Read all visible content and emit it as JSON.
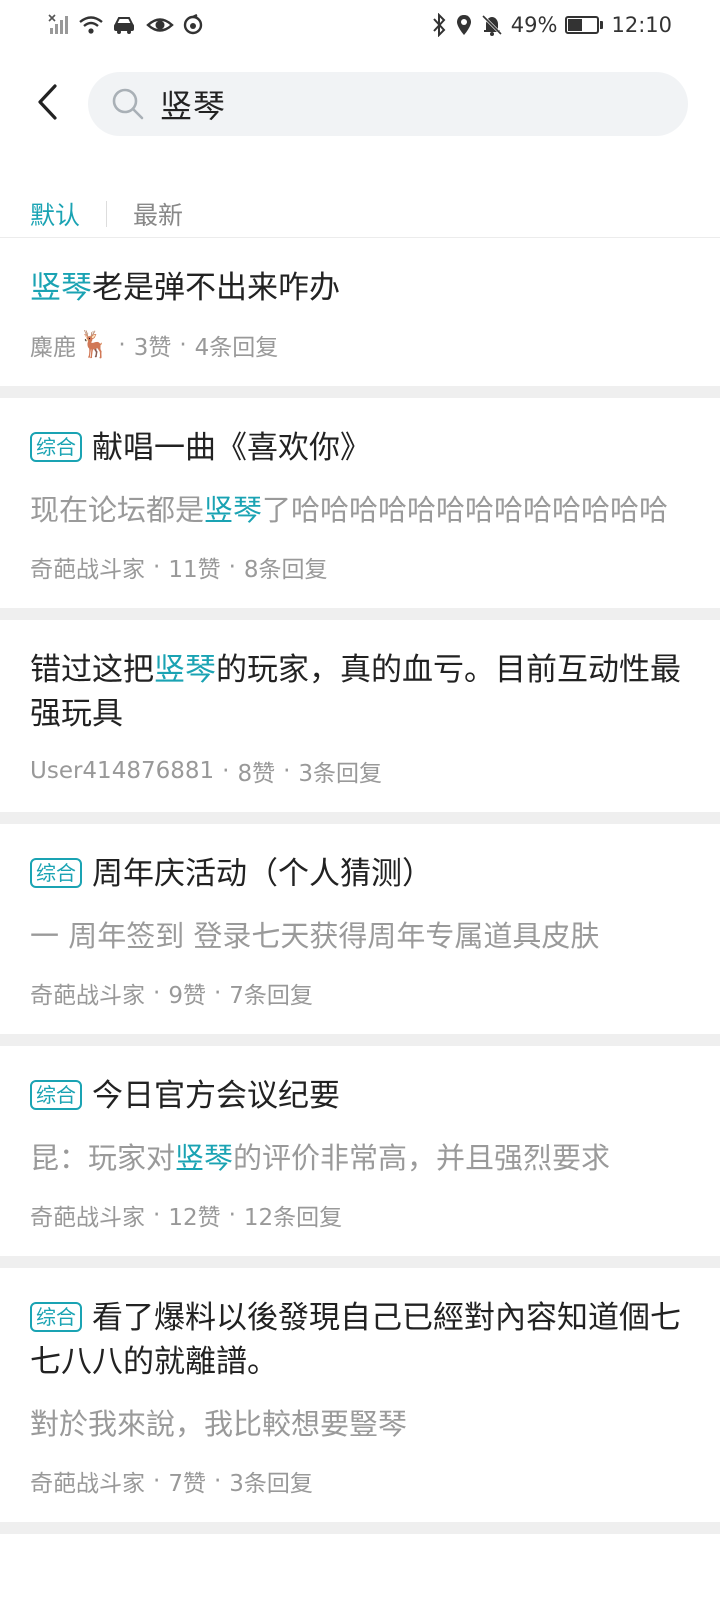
{
  "status_bar": {
    "battery_percent": "49%",
    "battery_level": 0.49,
    "time": "12:10"
  },
  "search": {
    "query": "竖琴"
  },
  "tabs": [
    {
      "label": "默认",
      "active": true
    },
    {
      "label": "最新",
      "active": false
    }
  ],
  "colors": {
    "accent": "#1aa3b3",
    "muted": "#999999"
  },
  "posts": [
    {
      "tag": "",
      "title_pre": "",
      "title_hl": "竖琴",
      "title_post": "老是弹不出来咋办",
      "excerpt_pre": "",
      "excerpt_hl": "",
      "excerpt_post": "",
      "author": "麋鹿",
      "author_emoji": "🦌",
      "likes": "3赞",
      "replies": "4条回复"
    },
    {
      "tag": "综合",
      "title_pre": "献唱一曲《喜欢你》",
      "title_hl": "",
      "title_post": "",
      "excerpt_pre": "现在论坛都是",
      "excerpt_hl": "竖琴",
      "excerpt_post": "了哈哈哈哈哈哈哈哈哈哈哈哈哈",
      "author": "奇葩战斗家",
      "author_emoji": "",
      "likes": "11赞",
      "replies": "8条回复"
    },
    {
      "tag": "",
      "title_pre": "错过这把",
      "title_hl": "竖琴",
      "title_post": "的玩家，真的血亏。目前互动性最强玩具",
      "excerpt_pre": "",
      "excerpt_hl": "",
      "excerpt_post": "",
      "author": "User414876881",
      "author_emoji": "",
      "likes": "8赞",
      "replies": "3条回复"
    },
    {
      "tag": "综合",
      "title_pre": "周年庆活动（个人猜测）",
      "title_hl": "",
      "title_post": "",
      "excerpt_pre": "一 周年签到 登录七天获得周年专属道具皮肤",
      "excerpt_hl": "",
      "excerpt_post": "",
      "author": "奇葩战斗家",
      "author_emoji": "",
      "likes": "9赞",
      "replies": "7条回复"
    },
    {
      "tag": "综合",
      "title_pre": "今日官方会议纪要",
      "title_hl": "",
      "title_post": "",
      "excerpt_pre": "昆：玩家对",
      "excerpt_hl": "竖琴",
      "excerpt_post": "的评价非常高，并且强烈要求",
      "author": "奇葩战斗家",
      "author_emoji": "",
      "likes": "12赞",
      "replies": "12条回复"
    },
    {
      "tag": "综合",
      "title_pre": "看了爆料以後發現自己已經對內容知道個七七八八的就離譜。",
      "title_hl": "",
      "title_post": "",
      "excerpt_pre": "對於我來說，我比較想要豎琴",
      "excerpt_hl": "",
      "excerpt_post": "",
      "author": "奇葩战斗家",
      "author_emoji": "",
      "likes": "7赞",
      "replies": "3条回复"
    }
  ]
}
